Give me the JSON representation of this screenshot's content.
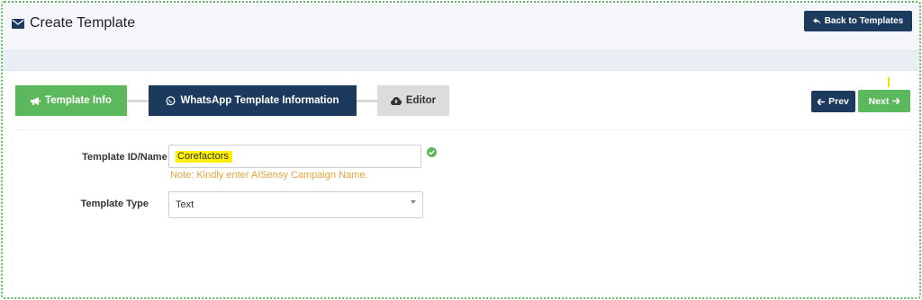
{
  "header": {
    "title": "Create Template",
    "back_button_label": "Back to Templates"
  },
  "steps": [
    {
      "label": "Template Info",
      "icon": "megaphone-icon"
    },
    {
      "label": "WhatsApp Template Information",
      "icon": "whatsapp-icon"
    },
    {
      "label": "Editor",
      "icon": "cloud-upload-icon"
    }
  ],
  "nav": {
    "prev_label": "Prev",
    "next_label": "Next"
  },
  "form": {
    "template_id": {
      "label": "Template ID/Name",
      "required_mark": "*",
      "value": "Corefactors",
      "note": "Note: Kindly enter AISensy Campaign Name."
    },
    "template_type": {
      "label": "Template Type",
      "selected": "Text"
    }
  },
  "colors": {
    "navy": "#1b3a5e",
    "green": "#5cb85c",
    "note_orange": "#e8a33d",
    "highlight_yellow": "#fff100",
    "required_red": "#d9302c"
  }
}
